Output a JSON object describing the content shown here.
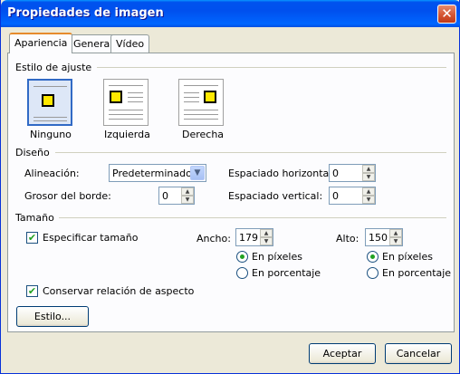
{
  "window": {
    "title": "Propiedades de imagen",
    "close_glyph": "✕"
  },
  "tabs": [
    {
      "label": "Apariencia",
      "active": true
    },
    {
      "label": "General",
      "active": false
    },
    {
      "label": "Vídeo",
      "active": false
    }
  ],
  "wrap_style": {
    "heading": "Estilo de ajuste",
    "options": [
      {
        "label": "Ninguno",
        "icon": "wrap-none-icon",
        "selected": true
      },
      {
        "label": "Izquierda",
        "icon": "wrap-left-icon",
        "selected": false
      },
      {
        "label": "Derecha",
        "icon": "wrap-right-icon",
        "selected": false
      }
    ]
  },
  "design": {
    "heading": "Diseño",
    "alignment_label": "Alineación:",
    "alignment_value": "Predeterminado",
    "border_label": "Grosor del borde:",
    "border_value": "0",
    "hspace_label": "Espaciado horizontal:",
    "hspace_value": "0",
    "vspace_label": "Espaciado vertical:",
    "vspace_value": "0"
  },
  "size": {
    "heading": "Tamaño",
    "specify_label": "Especificar tamaño",
    "specify_checked": true,
    "width_label": "Ancho:",
    "width_value": "179",
    "height_label": "Alto:",
    "height_value": "150",
    "pixels_label": "En píxeles",
    "percent_label": "En porcentaje",
    "keep_ratio_label": "Conservar relación de aspecto",
    "keep_ratio_checked": true,
    "style_button": "Estilo..."
  },
  "buttons": {
    "ok": "Aceptar",
    "cancel": "Cancelar"
  },
  "check_glyph": "✔",
  "arrow_glyph": "▼",
  "spin_up_glyph": "▲",
  "spin_down_glyph": "▼"
}
